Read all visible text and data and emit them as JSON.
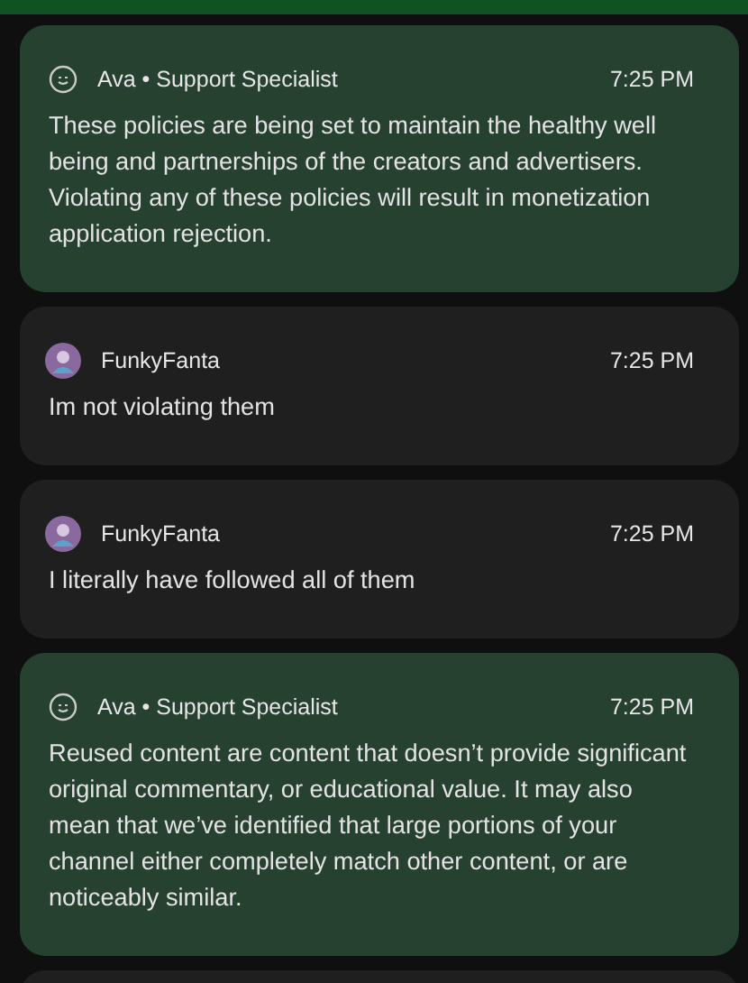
{
  "messages": [
    {
      "kind": "agent",
      "author": "Ava • Support Specialist",
      "time": "7:25 PM",
      "text": "These policies are being set to maintain the healthy well being and partnerships of the creators and advertisers. Violating any of these policies will result in monetization application rejection."
    },
    {
      "kind": "user",
      "author": "FunkyFanta",
      "time": "7:25 PM",
      "text": "Im not violating them"
    },
    {
      "kind": "user",
      "author": "FunkyFanta",
      "time": "7:25 PM",
      "text": "I literally have followed all of them"
    },
    {
      "kind": "agent",
      "author": "Ava • Support Specialist",
      "time": "7:25 PM",
      "text": "Reused content are content that doesn’t provide significant original commentary, or educational value. It may also mean that we’ve identified that large portions of your channel either completely match other content, or are noticeably similar."
    }
  ]
}
